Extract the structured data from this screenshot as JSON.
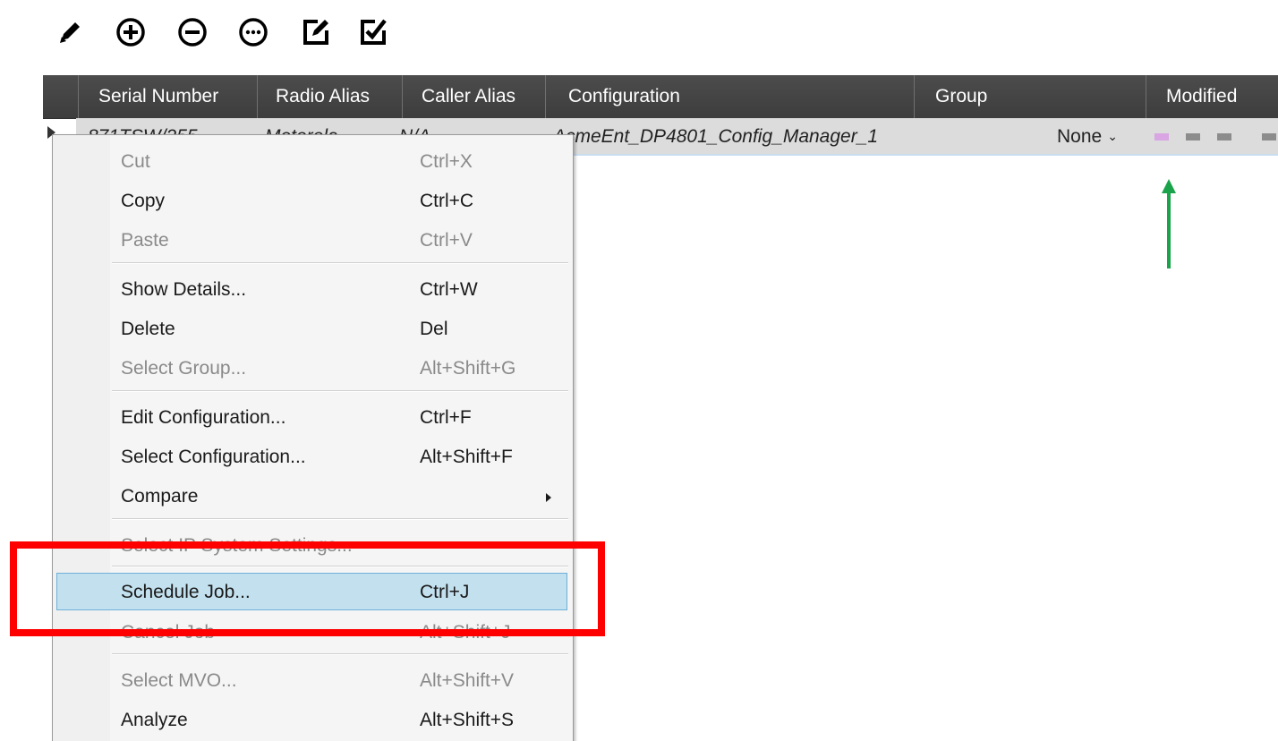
{
  "toolbar": {
    "icons": [
      "pencil-icon",
      "add-circle-icon",
      "remove-circle-icon",
      "more-circle-icon",
      "edit-box-icon",
      "check-box-edit-icon"
    ]
  },
  "table": {
    "columns": [
      "Serial Number",
      "Radio Alias",
      "Caller Alias",
      "Configuration",
      "Group",
      "Modified"
    ],
    "row": {
      "serial_number": "871TSW/255",
      "radio_alias": "Motorola",
      "caller_alias": "N/A",
      "configuration": "AcmeEnt_DP4801_Config_Manager_1",
      "group": "None",
      "modified_status_colors": [
        "#d9a5e3",
        "#8c8c8c",
        "#8c8c8c",
        "#8c8c8c"
      ]
    }
  },
  "context_menu": {
    "items": [
      {
        "label": "Cut",
        "shortcut": "Ctrl+X",
        "enabled": false
      },
      {
        "label": "Copy",
        "shortcut": "Ctrl+C",
        "enabled": true
      },
      {
        "label": "Paste",
        "shortcut": "Ctrl+V",
        "enabled": false
      },
      {
        "label": "Show Details...",
        "shortcut": "Ctrl+W",
        "enabled": true
      },
      {
        "label": "Delete",
        "shortcut": "Del",
        "enabled": true
      },
      {
        "label": "Select Group...",
        "shortcut": "Alt+Shift+G",
        "enabled": false
      },
      {
        "label": "Edit Configuration...",
        "shortcut": "Ctrl+F",
        "enabled": true
      },
      {
        "label": "Select Configuration...",
        "shortcut": "Alt+Shift+F",
        "enabled": true
      },
      {
        "label": "Compare",
        "shortcut": "",
        "enabled": true
      },
      {
        "label": "Select IP System Settings...",
        "shortcut": "",
        "enabled": false
      },
      {
        "label": "Schedule Job...",
        "shortcut": "Ctrl+J",
        "enabled": true,
        "highlighted": true
      },
      {
        "label": "Cancel Job",
        "shortcut": "Alt+Shift+J",
        "enabled": false
      },
      {
        "label": "Select MVO...",
        "shortcut": "Alt+Shift+V",
        "enabled": false
      },
      {
        "label": "Analyze",
        "shortcut": "Alt+Shift+S",
        "enabled": true
      }
    ]
  },
  "annotations": {
    "highlight_box_color": "#ff0000",
    "arrow_color": "#1aa34a"
  }
}
